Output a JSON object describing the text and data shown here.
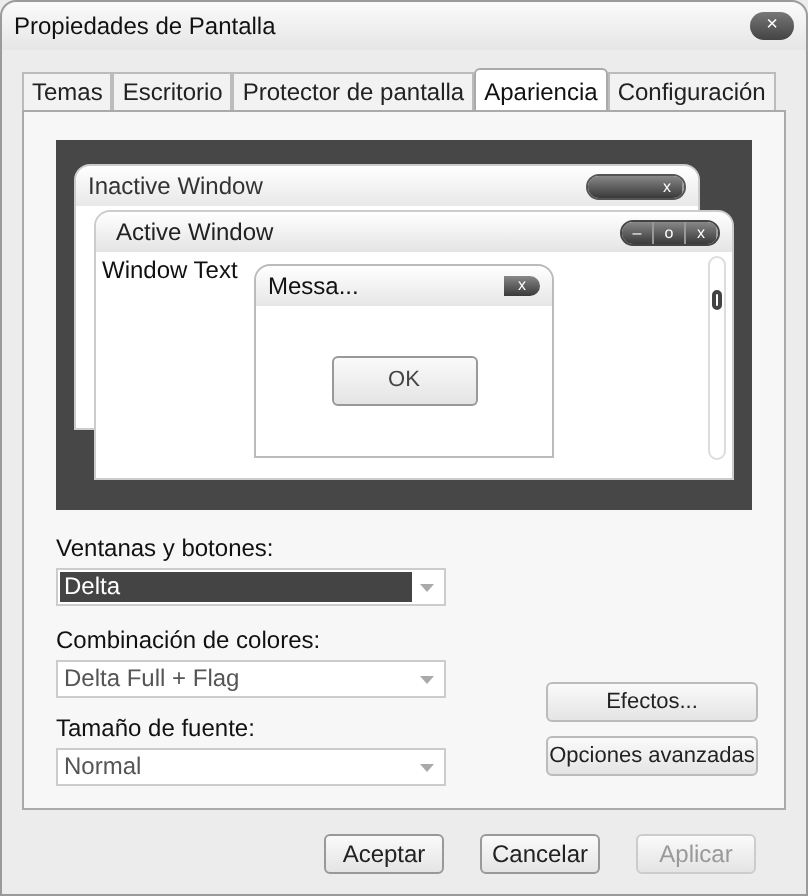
{
  "window": {
    "title": "Propiedades de Pantalla",
    "close": "×"
  },
  "tabs": [
    {
      "label": "Temas",
      "selected": false
    },
    {
      "label": "Escritorio",
      "selected": false
    },
    {
      "label": "Protector de pantalla",
      "selected": false
    },
    {
      "label": "Apariencia",
      "selected": true
    },
    {
      "label": "Configuración",
      "selected": false
    }
  ],
  "preview": {
    "inactive_window": {
      "title": "Inactive Window",
      "close": "x"
    },
    "active_window": {
      "title": "Active Window",
      "minimize": "–",
      "maximize": "o",
      "close": "x",
      "window_text": "Window Text"
    },
    "message_box": {
      "title": "Messa...",
      "close": "x",
      "button": "OK"
    }
  },
  "fields": [
    {
      "label": "Ventanas y botones:",
      "value": "Delta",
      "highlighted": true
    },
    {
      "label": "Combinación de colores:",
      "value": "Delta Full + Flag",
      "highlighted": false
    },
    {
      "label": "Tamaño de fuente:",
      "value": "Normal",
      "highlighted": false
    }
  ],
  "side_buttons": [
    {
      "label": "Efectos..."
    },
    {
      "label": "Opciones avanzadas"
    }
  ],
  "buttons": [
    {
      "label": "Aceptar",
      "disabled": false
    },
    {
      "label": "Cancelar",
      "disabled": false
    },
    {
      "label": "Aplicar",
      "disabled": true
    }
  ]
}
